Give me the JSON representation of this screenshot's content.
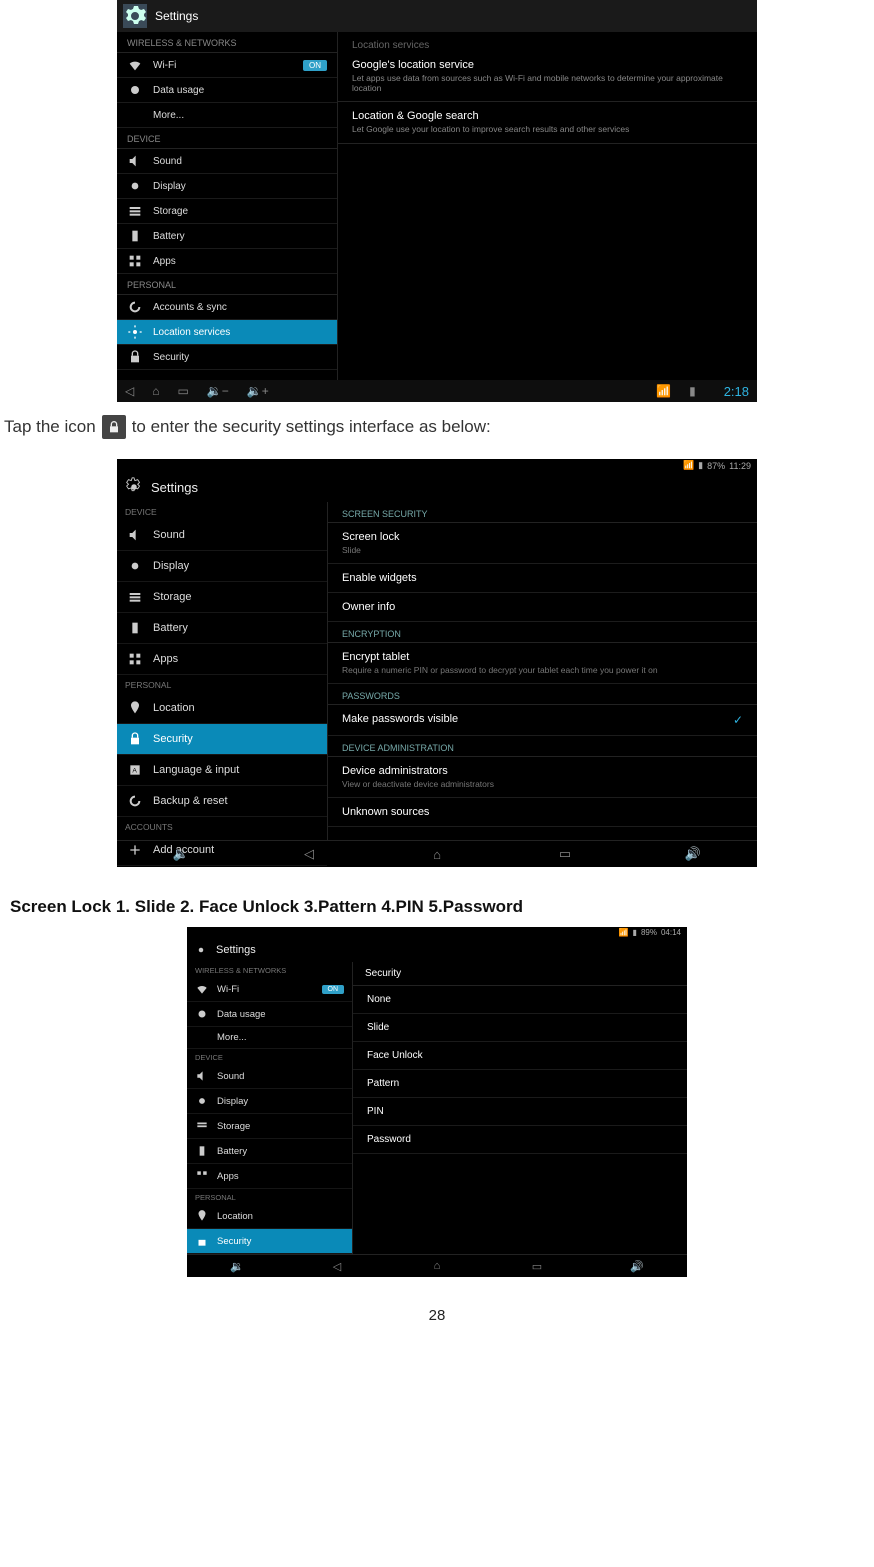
{
  "instruction": {
    "pre": "Tap the icon",
    "post": " to enter the security settings interface as below:"
  },
  "heading": "Screen Lock 1. Slide 2. Face Unlock 3.Pattern 4.PIN 5.Password",
  "page_number": "28",
  "shot1": {
    "title": "Settings",
    "wireless_label": "WIRELESS & NETWORKS",
    "wifi": "Wi-Fi",
    "wifi_toggle": "ON",
    "data": "Data usage",
    "more": "More...",
    "device_label": "DEVICE",
    "sound": "Sound",
    "display": "Display",
    "storage": "Storage",
    "battery": "Battery",
    "apps": "Apps",
    "personal_label": "PERSONAL",
    "accounts": "Accounts & sync",
    "location": "Location services",
    "security": "Security",
    "right_header": "Location services",
    "g1_title": "Google's location service",
    "g1_sub": "Let apps use data from sources such as Wi-Fi and mobile networks to determine your approximate location",
    "g2_title": "Location & Google search",
    "g2_sub": "Let Google use your location to improve search results and other services",
    "clock": "2:18"
  },
  "shot2": {
    "status_batt": "87%",
    "status_time": "11:29",
    "title": "Settings",
    "device_label": "DEVICE",
    "sound": "Sound",
    "display": "Display",
    "storage": "Storage",
    "battery": "Battery",
    "apps": "Apps",
    "personal_label": "PERSONAL",
    "location": "Location",
    "security": "Security",
    "lang": "Language & input",
    "backup": "Backup & reset",
    "accounts_label": "ACCOUNTS",
    "add": "Add account",
    "sec_screen": "SCREEN SECURITY",
    "screenlock": "Screen lock",
    "screenlock_sub": "Slide",
    "widgets": "Enable widgets",
    "owner": "Owner info",
    "sec_enc": "ENCRYPTION",
    "enc_title": "Encrypt tablet",
    "enc_sub": "Require a numeric PIN or password to decrypt your tablet each time you power it on",
    "sec_pw": "PASSWORDS",
    "pwvis": "Make passwords visible",
    "sec_da": "DEVICE ADMINISTRATION",
    "da_title": "Device administrators",
    "da_sub": "View or deactivate device administrators",
    "unknown": "Unknown sources"
  },
  "shot3": {
    "status_batt": "89%",
    "status_time": "04:14",
    "title": "Settings",
    "wireless_label": "WIRELESS & NETWORKS",
    "wifi": "Wi-Fi",
    "wifi_toggle": "ON",
    "data": "Data usage",
    "more": "More...",
    "device_label": "DEVICE",
    "sound": "Sound",
    "display": "Display",
    "storage": "Storage",
    "battery": "Battery",
    "apps": "Apps",
    "personal_label": "PERSONAL",
    "location": "Location",
    "security": "Security",
    "right_title": "Security",
    "opt_none": "None",
    "opt_slide": "Slide",
    "opt_face": "Face Unlock",
    "opt_pattern": "Pattern",
    "opt_pin": "PIN",
    "opt_password": "Password"
  }
}
